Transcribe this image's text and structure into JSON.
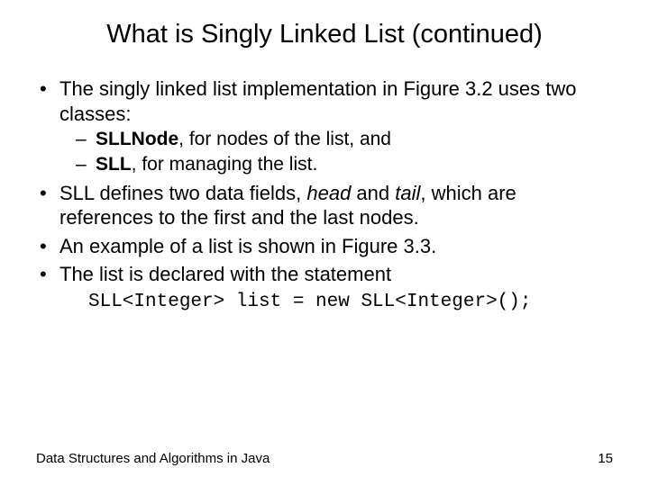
{
  "title": "What is Singly Linked List (continued)",
  "bullets": {
    "b1_pre": "The singly linked list implementation in Figure 3.2 uses two classes:",
    "b1a_bold": "SLLNode",
    "b1a_rest": ", for nodes of the list, and",
    "b1b_bold": "SLL",
    "b1b_rest": ", for managing the list.",
    "b2_pre": "SLL defines two data fields, ",
    "b2_it1": "head",
    "b2_mid": " and ",
    "b2_it2": "tail",
    "b2_post": ", which are references to the first and the last nodes.",
    "b3": "An example of a list is shown in Figure 3.3.",
    "b4": "The list is declared with the statement"
  },
  "code_line": "SLL<Integer> list = new SLL<Integer>();",
  "footer": {
    "left": "Data Structures and Algorithms in Java",
    "right": "15"
  }
}
